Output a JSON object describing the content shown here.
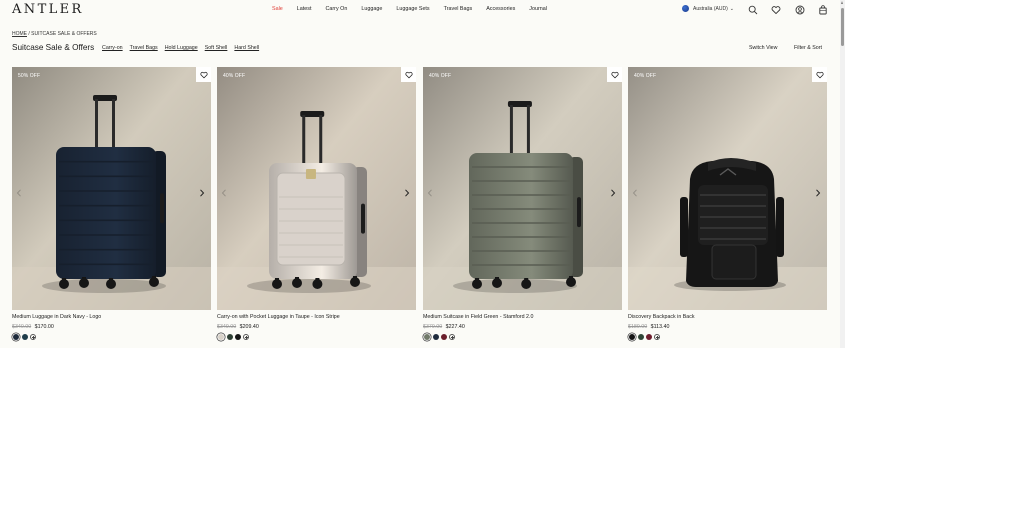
{
  "header": {
    "logo": "ANTLER",
    "nav": [
      "Sale",
      "Latest",
      "Carry On",
      "Luggage",
      "Luggage Sets",
      "Travel Bags",
      "Accessories",
      "Journal"
    ],
    "locale": "Australia  (AUD)",
    "icons": [
      "search-icon",
      "heart-icon",
      "account-icon",
      "bag-icon"
    ]
  },
  "breadcrumb": {
    "home": "HOME",
    "separator": " / ",
    "current": "SUITCASE SALE & OFFERS"
  },
  "page_title": "Suitcase Sale & Offers",
  "filters": [
    "Carry-on",
    "Travel Bags",
    "Hold Luggage",
    "Soft Shell",
    "Hard Shell"
  ],
  "switch_view": "Switch View",
  "filter_sort": "Filter & Sort",
  "colors": {
    "sale": "#e0413a",
    "text": "#1a1a1a",
    "background": "#fbfbf7"
  },
  "products": [
    {
      "badge": "50% OFF",
      "name": "Medium Luggage in Dark Navy - Logo",
      "was": "$340.00",
      "price": "$170.00",
      "swatches": [
        "#1d2a3a",
        "#1f3d4a"
      ],
      "type": "suitcase",
      "body": "#1e2b3d",
      "bg": "#c8c1b3"
    },
    {
      "badge": "40% OFF",
      "name": "Carry-on with Pocket Luggage in Taupe - Icon Stripe",
      "was": "$349.00",
      "price": "$209.40",
      "swatches": [
        "#d8d2c9",
        "#2e4034",
        "#151515"
      ],
      "type": "suitcase",
      "body": "#e2dbd3",
      "bg": "#cdc4b6"
    },
    {
      "badge": "40% OFF",
      "name": "Medium Suitcase in Field Green - Stamford 2.0",
      "was": "$379.00",
      "price": "$227.40",
      "swatches": [
        "#717a6a",
        "#1f2c3d",
        "#6b1f2c"
      ],
      "type": "suitcase",
      "body": "#7b8172",
      "bg": "#c9c3b6"
    },
    {
      "badge": "40% OFF",
      "name": "Discovery Backpack in Back",
      "was": "$189.00",
      "price": "$113.40",
      "swatches": [
        "#141414",
        "#2f4536",
        "#6e1e2e"
      ],
      "type": "backpack",
      "body": "#1a1a1a",
      "bg": "#cfc8bb"
    }
  ]
}
